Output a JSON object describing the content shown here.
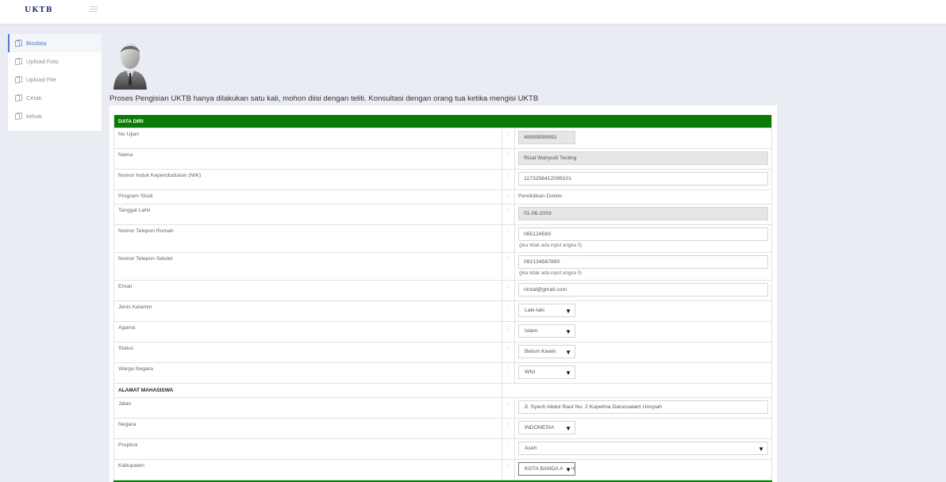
{
  "app": {
    "brand": "UKTB"
  },
  "sidebar": {
    "items": [
      {
        "label": "Biodata",
        "active": true
      },
      {
        "label": "Upload Foto",
        "active": false
      },
      {
        "label": "Upload File",
        "active": false
      },
      {
        "label": "Cetak",
        "active": false
      },
      {
        "label": "keluar",
        "active": false
      }
    ]
  },
  "notice": "Proses Pengisian UKTB hanya dilakukan satu kali, mohon diisi dengan teliti. Konsultasi dengan orang tua ketika mengisi UKTB",
  "form": {
    "separator": ":",
    "data_diri_title": "DATA DIRI",
    "alamat_title": "ALAMAT MAHASISWA",
    "no_ujian": {
      "label": "No Ujian",
      "value": "49999999992"
    },
    "nama": {
      "label": "Nama",
      "value": "Rizal Wahyudi Testing"
    },
    "nik": {
      "label": "Nomor Induk Kependudukan (NIK)",
      "value": "1173256412099101"
    },
    "prodi": {
      "label": "Program Studi",
      "value": "Pendidikan Dokter"
    },
    "tgl_lahir": {
      "label": "Tanggal Lahir",
      "value": "01-06-2003"
    },
    "telp_rumah": {
      "label": "Nomor Telepon Rumah",
      "value": "065124593",
      "hint": "(jika tidak ada input angka 0)"
    },
    "telp_seluler": {
      "label": "Nomor Telepon Seluler",
      "value": "082134567890",
      "hint": "(jika tidak ada input angka 0)"
    },
    "email": {
      "label": "Email",
      "value": "ririzal@gmail.com"
    },
    "jenis_kelamin": {
      "label": "Jenis Kelamin",
      "value": "Laki-laki"
    },
    "agama": {
      "label": "Agama",
      "value": "Islam"
    },
    "status": {
      "label": "Status",
      "value": "Belum Kawin"
    },
    "warga_negara": {
      "label": "Warga Negara",
      "value": "WNI"
    },
    "jalan": {
      "label": "Jalan",
      "value": "Jl. Syech Abdul Rauf No. 2 Kopelma Darussalam Unsyiah"
    },
    "negara": {
      "label": "Negara",
      "value": "INDONESIA"
    },
    "propinsi": {
      "label": "Propinsi",
      "value": "Aceh"
    },
    "kabupaten": {
      "label": "Kabupaten",
      "value": "KOTA BANDA ACEH"
    }
  },
  "colors": {
    "header_green": "#0a7a06",
    "active_blue": "#4a7bd0",
    "brand_navy": "#1f2f6a"
  },
  "icons": {
    "menu": "hamburger-icon",
    "nav": "copy-document-icon",
    "avatar": "user-silhouette-icon",
    "dropdown": "caret-down-icon"
  }
}
